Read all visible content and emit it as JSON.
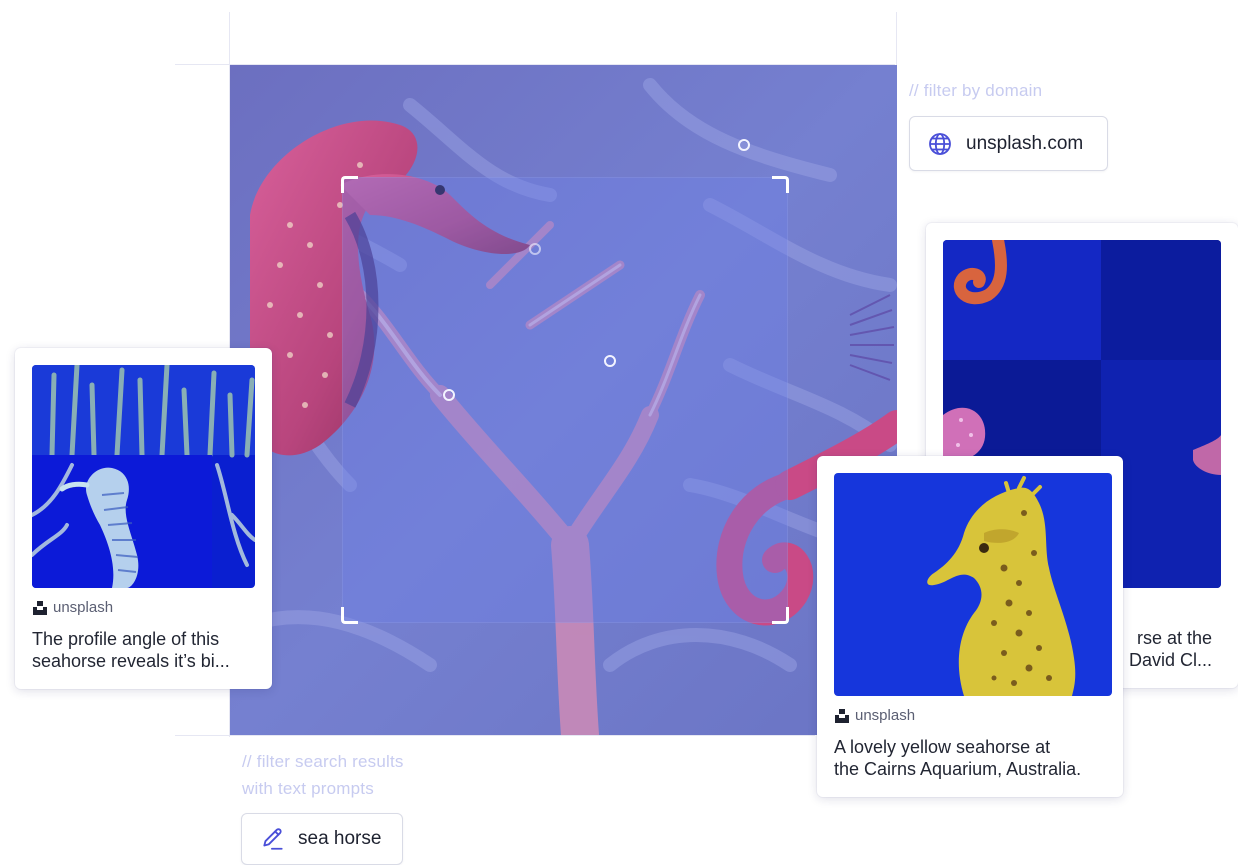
{
  "filters": {
    "domain_comment": "// filter by domain",
    "domain_value": "unsplash.com",
    "text_comment_line1": "// filter search results",
    "text_comment_line2": "with text prompts",
    "text_prompt_value": "sea horse"
  },
  "results": [
    {
      "source": "unsplash",
      "caption_line1": "The profile angle of this",
      "caption_line2": "seahorse reveals it’s bi..."
    },
    {
      "source_partial_line1": "rse at the",
      "source_partial_line2": "David Cl..."
    },
    {
      "source": "unsplash",
      "caption_line1": "A lovely yellow seahorse at",
      "caption_line2": "the Cairns Aquarium, Australia."
    }
  ],
  "colors": {
    "accent_light": "#c7cbf0",
    "scene_blue": "#6e79c9",
    "deep_blue": "#1630d8"
  },
  "icons": [
    "globe-icon",
    "pencil-icon",
    "unsplash-logo-icon"
  ]
}
